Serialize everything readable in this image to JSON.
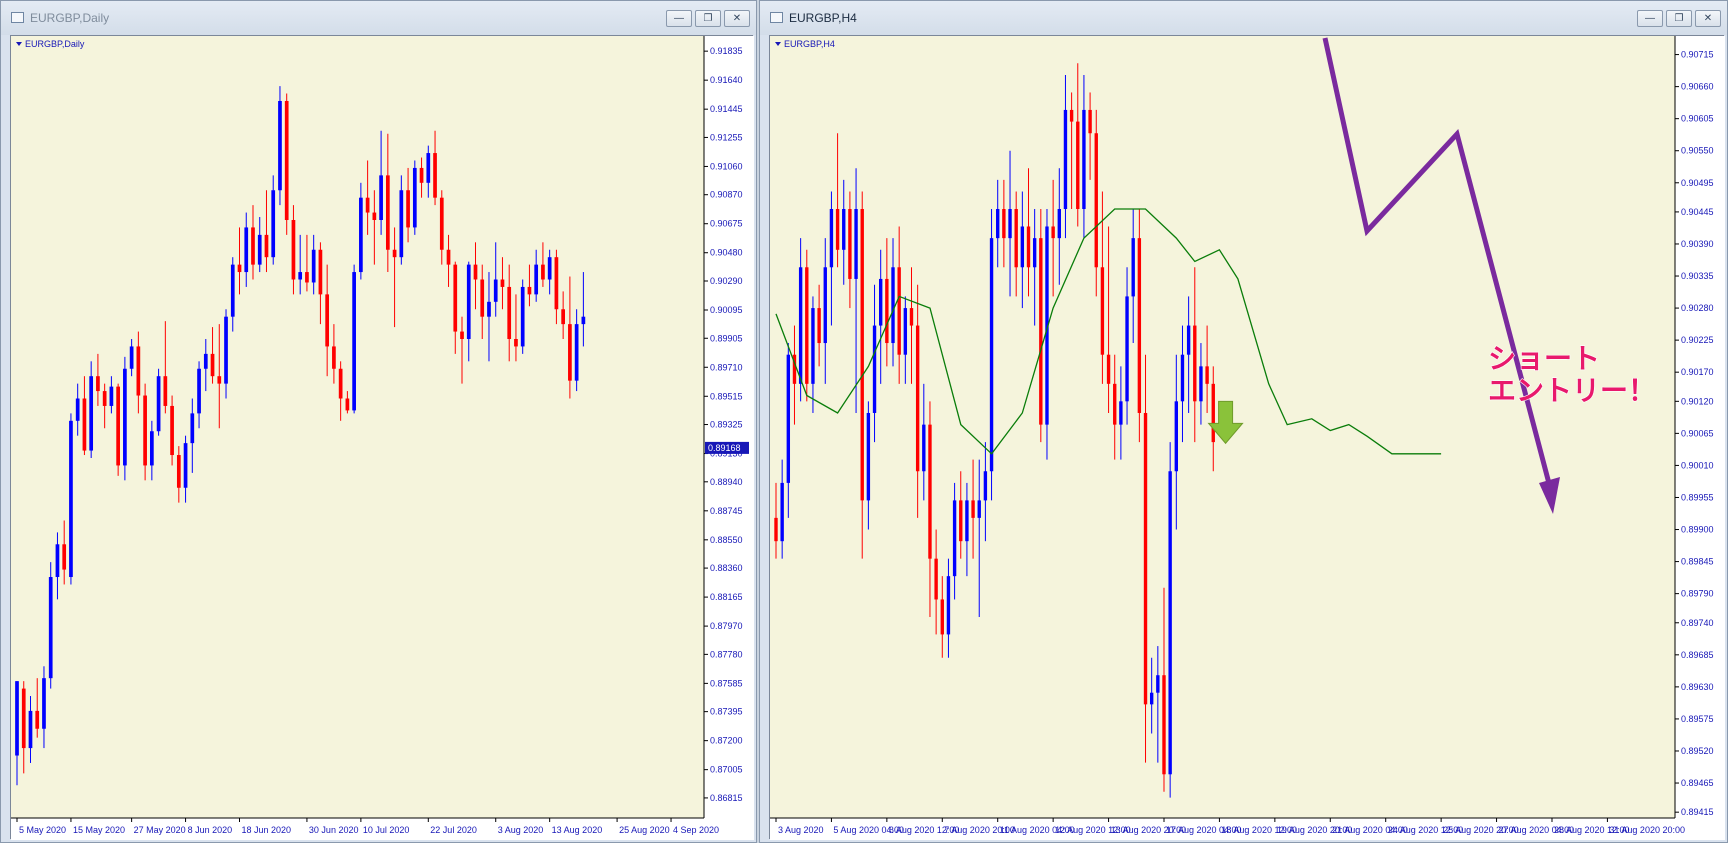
{
  "windows": {
    "left": {
      "title": "EURGBP,Daily",
      "symbol_label": "EURGBP,Daily"
    },
    "right": {
      "title": "EURGBP,H4",
      "symbol_label": "EURGBP,H4"
    }
  },
  "window_controls": {
    "minimize": "—",
    "restore": "❐",
    "close": "✕"
  },
  "annotation": {
    "line1": "ショート",
    "line2": "エントリー！"
  },
  "colors": {
    "chart_bg": "#f5f4dc",
    "bull": "#0000ff",
    "bear": "#ff0000",
    "axis": "#1717b7",
    "ma": "#0a7d0a",
    "zigzag": "#7a2a9e",
    "entry_arrow": "#8ac23a",
    "annotation_text": "#e8196c",
    "price_tag": "#1717b7"
  },
  "chart_data": [
    {
      "type": "candlestick",
      "title": "EURGBP,Daily",
      "ylim": [
        0.8668,
        0.9191
      ],
      "yticks": [
        0.91835,
        0.9164,
        0.91445,
        0.91255,
        0.9106,
        0.9087,
        0.90675,
        0.9048,
        0.9029,
        0.90095,
        0.89905,
        0.8971,
        0.89515,
        0.89325,
        0.8913,
        0.8894,
        0.88745,
        0.8855,
        0.8836,
        0.88165,
        0.8797,
        0.8778,
        0.87585,
        0.87395,
        0.872,
        0.87005,
        0.86815
      ],
      "xticks": [
        {
          "i": 0,
          "label": "5 May 2020"
        },
        {
          "i": 8,
          "label": "15 May 2020"
        },
        {
          "i": 17,
          "label": "27 May 2020"
        },
        {
          "i": 25,
          "label": "8 Jun 2020"
        },
        {
          "i": 33,
          "label": "18 Jun 2020"
        },
        {
          "i": 43,
          "label": "30 Jun 2020"
        },
        {
          "i": 51,
          "label": "10 Jul 2020"
        },
        {
          "i": 61,
          "label": "22 Jul 2020"
        },
        {
          "i": 71,
          "label": "3 Aug 2020"
        },
        {
          "i": 79,
          "label": "13 Aug 2020"
        },
        {
          "i": 89,
          "label": "25 Aug 2020"
        },
        {
          "i": 97,
          "label": "4 Sep 2020"
        }
      ],
      "xlim": [
        0,
        101
      ],
      "current_price": "0.89168",
      "candles": [
        [
          0.871,
          0.876,
          0.869,
          0.876
        ],
        [
          0.8755,
          0.876,
          0.8698,
          0.8715
        ],
        [
          0.8715,
          0.875,
          0.8705,
          0.874
        ],
        [
          0.874,
          0.8762,
          0.8722,
          0.8728
        ],
        [
          0.8728,
          0.877,
          0.8715,
          0.8762
        ],
        [
          0.8762,
          0.884,
          0.8755,
          0.883
        ],
        [
          0.883,
          0.886,
          0.8815,
          0.8852
        ],
        [
          0.8852,
          0.8868,
          0.8825,
          0.8835
        ],
        [
          0.883,
          0.894,
          0.8825,
          0.8935
        ],
        [
          0.8935,
          0.896,
          0.8925,
          0.895
        ],
        [
          0.895,
          0.8965,
          0.8912,
          0.8915
        ],
        [
          0.8915,
          0.8975,
          0.891,
          0.8965
        ],
        [
          0.8965,
          0.898,
          0.8945,
          0.8955
        ],
        [
          0.8955,
          0.896,
          0.893,
          0.8945
        ],
        [
          0.8945,
          0.8965,
          0.894,
          0.8958
        ],
        [
          0.8958,
          0.896,
          0.8898,
          0.8905
        ],
        [
          0.8905,
          0.8978,
          0.8895,
          0.897
        ],
        [
          0.897,
          0.899,
          0.8965,
          0.8985
        ],
        [
          0.8985,
          0.8995,
          0.894,
          0.8952
        ],
        [
          0.8952,
          0.896,
          0.8895,
          0.8905
        ],
        [
          0.8905,
          0.8935,
          0.8895,
          0.8928
        ],
        [
          0.8928,
          0.897,
          0.8925,
          0.8965
        ],
        [
          0.8965,
          0.9002,
          0.894,
          0.8945
        ],
        [
          0.8945,
          0.8952,
          0.8905,
          0.8912
        ],
        [
          0.8912,
          0.8918,
          0.888,
          0.889
        ],
        [
          0.889,
          0.8925,
          0.888,
          0.892
        ],
        [
          0.892,
          0.895,
          0.89,
          0.894
        ],
        [
          0.894,
          0.8975,
          0.893,
          0.897
        ],
        [
          0.897,
          0.899,
          0.8955,
          0.898
        ],
        [
          0.898,
          0.8998,
          0.896,
          0.8965
        ],
        [
          0.8965,
          0.9,
          0.893,
          0.896
        ],
        [
          0.896,
          0.901,
          0.895,
          0.9005
        ],
        [
          0.9005,
          0.9045,
          0.8995,
          0.904
        ],
        [
          0.904,
          0.9065,
          0.902,
          0.9035
        ],
        [
          0.9035,
          0.9075,
          0.9025,
          0.9065
        ],
        [
          0.9065,
          0.908,
          0.903,
          0.904
        ],
        [
          0.904,
          0.9072,
          0.9035,
          0.906
        ],
        [
          0.906,
          0.909,
          0.9035,
          0.9045
        ],
        [
          0.9045,
          0.91,
          0.904,
          0.909
        ],
        [
          0.909,
          0.916,
          0.908,
          0.915
        ],
        [
          0.915,
          0.9155,
          0.906,
          0.907
        ],
        [
          0.907,
          0.908,
          0.902,
          0.903
        ],
        [
          0.903,
          0.906,
          0.902,
          0.9035
        ],
        [
          0.9035,
          0.906,
          0.9022,
          0.9028
        ],
        [
          0.9028,
          0.906,
          0.902,
          0.905
        ],
        [
          0.905,
          0.9055,
          0.9,
          0.902
        ],
        [
          0.902,
          0.904,
          0.8965,
          0.8985
        ],
        [
          0.8985,
          0.9,
          0.896,
          0.897
        ],
        [
          0.897,
          0.8975,
          0.8935,
          0.895
        ],
        [
          0.895,
          0.8955,
          0.894,
          0.8942
        ],
        [
          0.8942,
          0.904,
          0.894,
          0.9035
        ],
        [
          0.9035,
          0.9095,
          0.903,
          0.9085
        ],
        [
          0.9085,
          0.911,
          0.906,
          0.9075
        ],
        [
          0.9075,
          0.909,
          0.904,
          0.907
        ],
        [
          0.907,
          0.913,
          0.906,
          0.91
        ],
        [
          0.91,
          0.9128,
          0.9035,
          0.905
        ],
        [
          0.905,
          0.9065,
          0.8998,
          0.9045
        ],
        [
          0.9045,
          0.91,
          0.904,
          0.909
        ],
        [
          0.909,
          0.9105,
          0.9055,
          0.9065
        ],
        [
          0.9065,
          0.911,
          0.906,
          0.9105
        ],
        [
          0.9105,
          0.9112,
          0.9085,
          0.9095
        ],
        [
          0.9095,
          0.912,
          0.9085,
          0.9115
        ],
        [
          0.9115,
          0.913,
          0.908,
          0.9085
        ],
        [
          0.9085,
          0.909,
          0.904,
          0.905
        ],
        [
          0.905,
          0.906,
          0.9025,
          0.904
        ],
        [
          0.904,
          0.9042,
          0.898,
          0.8995
        ],
        [
          0.8995,
          0.9005,
          0.896,
          0.899
        ],
        [
          0.899,
          0.9042,
          0.8975,
          0.904
        ],
        [
          0.904,
          0.9055,
          0.901,
          0.903
        ],
        [
          0.903,
          0.904,
          0.899,
          0.9005
        ],
        [
          0.9005,
          0.9035,
          0.8975,
          0.9015
        ],
        [
          0.9015,
          0.9055,
          0.9005,
          0.903
        ],
        [
          0.903,
          0.9045,
          0.901,
          0.9025
        ],
        [
          0.9025,
          0.904,
          0.8975,
          0.899
        ],
        [
          0.899,
          0.902,
          0.8975,
          0.8985
        ],
        [
          0.8985,
          0.903,
          0.898,
          0.9025
        ],
        [
          0.9025,
          0.904,
          0.9012,
          0.902
        ],
        [
          0.902,
          0.905,
          0.9015,
          0.904
        ],
        [
          0.904,
          0.9055,
          0.9025,
          0.903
        ],
        [
          0.903,
          0.905,
          0.902,
          0.9045
        ],
        [
          0.9045,
          0.905,
          0.9,
          0.901
        ],
        [
          0.901,
          0.9022,
          0.899,
          0.9
        ],
        [
          0.9,
          0.9032,
          0.895,
          0.8962
        ],
        [
          0.8962,
          0.901,
          0.8955,
          0.9
        ],
        [
          0.9,
          0.9035,
          0.8985,
          0.9005
        ]
      ]
    },
    {
      "type": "candlestick",
      "title": "EURGBP,H4",
      "ylim": [
        0.89405,
        0.9074
      ],
      "yticks": [
        0.90715,
        0.9066,
        0.90605,
        0.9055,
        0.90495,
        0.90445,
        0.9039,
        0.90335,
        0.9028,
        0.90225,
        0.9017,
        0.9012,
        0.90065,
        0.9001,
        0.89955,
        0.899,
        0.89845,
        0.8979,
        0.8974,
        0.89685,
        0.8963,
        0.89575,
        0.8952,
        0.89465,
        0.89415
      ],
      "xticks": [
        {
          "i": 0,
          "label": "3 Aug 2020"
        },
        {
          "i": 9,
          "label": "5 Aug 2020 04:00"
        },
        {
          "i": 18,
          "label": "6 Aug 2020 12:00"
        },
        {
          "i": 27,
          "label": "7 Aug 2020 20:00"
        },
        {
          "i": 36,
          "label": "11 Aug 2020 04:00"
        },
        {
          "i": 45,
          "label": "12 Aug 2020 12:00"
        },
        {
          "i": 54,
          "label": "13 Aug 2020 20:00"
        },
        {
          "i": 63,
          "label": "17 Aug 2020 04:00"
        },
        {
          "i": 72,
          "label": "18 Aug 2020 12:00"
        },
        {
          "i": 81,
          "label": "19 Aug 2020 20:00"
        },
        {
          "i": 90,
          "label": "21 Aug 2020 04:00"
        },
        {
          "i": 99,
          "label": "24 Aug 2020 12:00"
        },
        {
          "i": 108,
          "label": "25 Aug 2020 20:00"
        },
        {
          "i": 117,
          "label": "27 Aug 2020 04:00"
        },
        {
          "i": 126,
          "label": "28 Aug 2020 12:00"
        },
        {
          "i": 135,
          "label": "31 Aug 2020 20:00"
        }
      ],
      "xlim": [
        0,
        145
      ],
      "ma": {
        "name": "",
        "x": [
          0,
          5,
          10,
          15,
          20,
          25,
          30,
          35,
          40,
          45,
          50,
          55,
          60,
          65,
          68,
          72,
          75,
          80,
          83,
          87,
          90,
          93,
          96,
          100,
          104,
          108
        ],
        "y": [
          0.9027,
          0.9013,
          0.901,
          0.9018,
          0.903,
          0.9028,
          0.9008,
          0.9003,
          0.901,
          0.9028,
          0.904,
          0.9045,
          0.9045,
          0.904,
          0.9036,
          0.9038,
          0.9033,
          0.9015,
          0.9008,
          0.9009,
          0.9007,
          0.9008,
          0.9006,
          0.9003,
          0.9003,
          0.9003
        ]
      },
      "candles": [
        [
          0.8992,
          0.8998,
          0.8985,
          0.8988
        ],
        [
          0.8988,
          0.9002,
          0.8985,
          0.8998
        ],
        [
          0.8998,
          0.9022,
          0.8992,
          0.902
        ],
        [
          0.902,
          0.9025,
          0.9008,
          0.9015
        ],
        [
          0.9015,
          0.904,
          0.9012,
          0.9035
        ],
        [
          0.9035,
          0.9038,
          0.9012,
          0.9015
        ],
        [
          0.9015,
          0.903,
          0.901,
          0.9028
        ],
        [
          0.9028,
          0.9032,
          0.9018,
          0.9022
        ],
        [
          0.9022,
          0.904,
          0.9015,
          0.9035
        ],
        [
          0.9035,
          0.9048,
          0.9025,
          0.9045
        ],
        [
          0.9045,
          0.9058,
          0.9035,
          0.9038
        ],
        [
          0.9038,
          0.905,
          0.9032,
          0.9045
        ],
        [
          0.9045,
          0.9048,
          0.9028,
          0.9033
        ],
        [
          0.9033,
          0.9052,
          0.901,
          0.9045
        ],
        [
          0.9045,
          0.9048,
          0.8985,
          0.8995
        ],
        [
          0.8995,
          0.9012,
          0.899,
          0.901
        ],
        [
          0.901,
          0.9032,
          0.9005,
          0.9025
        ],
        [
          0.9025,
          0.9038,
          0.9015,
          0.9033
        ],
        [
          0.9033,
          0.904,
          0.9018,
          0.9022
        ],
        [
          0.9022,
          0.904,
          0.9018,
          0.9035
        ],
        [
          0.9035,
          0.9042,
          0.9015,
          0.902
        ],
        [
          0.902,
          0.903,
          0.9015,
          0.9028
        ],
        [
          0.9028,
          0.9035,
          0.9015,
          0.9025
        ],
        [
          0.9025,
          0.9032,
          0.8992,
          0.9
        ],
        [
          0.9,
          0.9015,
          0.8995,
          0.9008
        ],
        [
          0.9008,
          0.9012,
          0.8975,
          0.8985
        ],
        [
          0.8985,
          0.899,
          0.8972,
          0.8978
        ],
        [
          0.8978,
          0.8982,
          0.8968,
          0.8972
        ],
        [
          0.8972,
          0.8985,
          0.8968,
          0.8982
        ],
        [
          0.8982,
          0.8998,
          0.8978,
          0.8995
        ],
        [
          0.8995,
          0.9,
          0.8985,
          0.8988
        ],
        [
          0.8988,
          0.8998,
          0.8982,
          0.8995
        ],
        [
          0.8995,
          0.9002,
          0.8985,
          0.8992
        ],
        [
          0.8992,
          0.9002,
          0.8975,
          0.8995
        ],
        [
          0.8995,
          0.9005,
          0.8988,
          0.9
        ],
        [
          0.9,
          0.9045,
          0.8995,
          0.904
        ],
        [
          0.904,
          0.905,
          0.9035,
          0.9045
        ],
        [
          0.9045,
          0.905,
          0.9035,
          0.904
        ],
        [
          0.904,
          0.9055,
          0.903,
          0.9045
        ],
        [
          0.9045,
          0.9048,
          0.903,
          0.9035
        ],
        [
          0.9035,
          0.9048,
          0.9028,
          0.9042
        ],
        [
          0.9042,
          0.9052,
          0.903,
          0.9035
        ],
        [
          0.9035,
          0.9045,
          0.9025,
          0.904
        ],
        [
          0.904,
          0.9045,
          0.9005,
          0.9008
        ],
        [
          0.9008,
          0.9045,
          0.9002,
          0.9042
        ],
        [
          0.9042,
          0.905,
          0.903,
          0.904
        ],
        [
          0.904,
          0.9052,
          0.9032,
          0.9045
        ],
        [
          0.9045,
          0.9068,
          0.904,
          0.9062
        ],
        [
          0.9062,
          0.9065,
          0.9045,
          0.906
        ],
        [
          0.906,
          0.907,
          0.9042,
          0.9045
        ],
        [
          0.9045,
          0.9068,
          0.904,
          0.9062
        ],
        [
          0.9062,
          0.9065,
          0.905,
          0.9058
        ],
        [
          0.9058,
          0.9062,
          0.903,
          0.9035
        ],
        [
          0.9035,
          0.9048,
          0.9015,
          0.902
        ],
        [
          0.902,
          0.9042,
          0.901,
          0.9015
        ],
        [
          0.9015,
          0.902,
          0.9002,
          0.9008
        ],
        [
          0.9008,
          0.9018,
          0.9002,
          0.9012
        ],
        [
          0.9012,
          0.9035,
          0.9008,
          0.903
        ],
        [
          0.903,
          0.9045,
          0.9022,
          0.904
        ],
        [
          0.904,
          0.9045,
          0.9005,
          0.901
        ],
        [
          0.901,
          0.902,
          0.895,
          0.896
        ],
        [
          0.896,
          0.8968,
          0.8955,
          0.8962
        ],
        [
          0.8962,
          0.897,
          0.895,
          0.8965
        ],
        [
          0.8965,
          0.898,
          0.8945,
          0.8948
        ],
        [
          0.8948,
          0.9005,
          0.8944,
          0.9
        ],
        [
          0.9,
          0.902,
          0.899,
          0.9012
        ],
        [
          0.9012,
          0.9025,
          0.9005,
          0.902
        ],
        [
          0.902,
          0.903,
          0.901,
          0.9025
        ],
        [
          0.9025,
          0.9035,
          0.9005,
          0.9012
        ],
        [
          0.9012,
          0.9022,
          0.9008,
          0.9018
        ],
        [
          0.9018,
          0.9025,
          0.901,
          0.9015
        ],
        [
          0.9015,
          0.9018,
          0.9,
          0.9005
        ]
      ]
    }
  ]
}
